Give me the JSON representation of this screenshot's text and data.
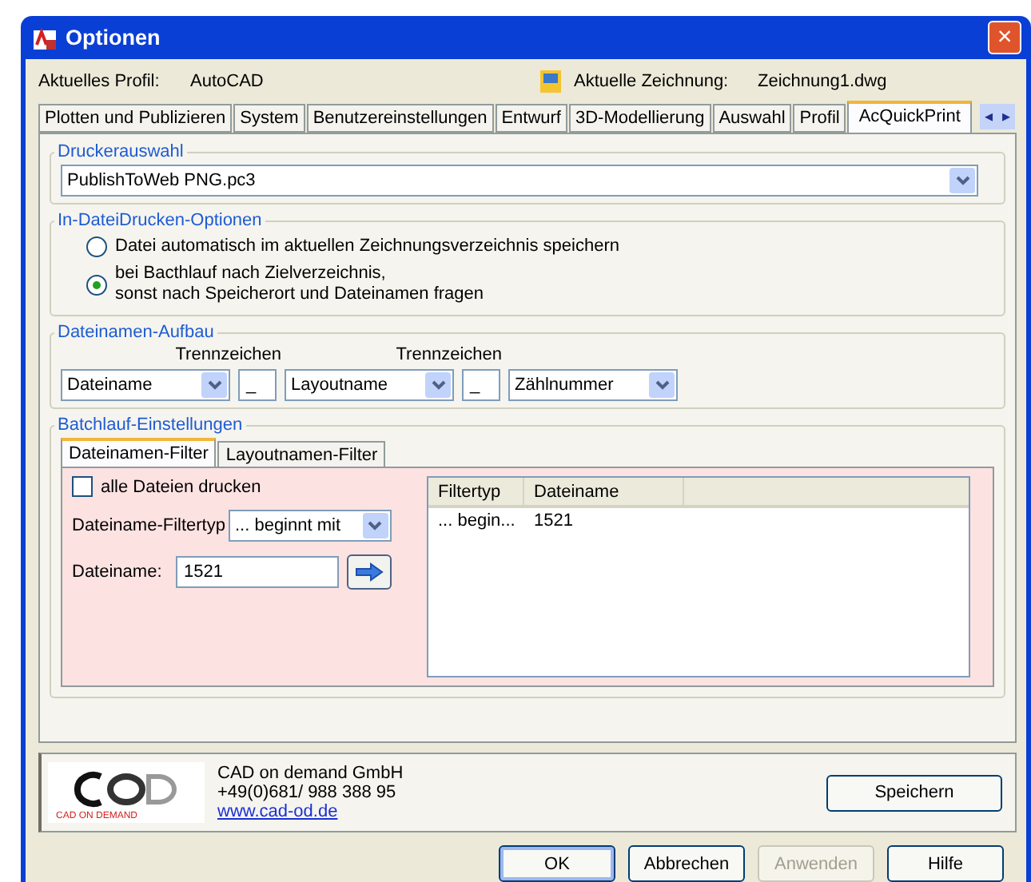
{
  "window": {
    "title": "Optionen",
    "close": "×"
  },
  "profile": {
    "label": "Aktuelles Profil:",
    "value": "AutoCAD",
    "drawing_label": "Aktuelle Zeichnung:",
    "drawing_value": "Zeichnung1.dwg"
  },
  "tabs": [
    {
      "label": "Plotten und Publizieren",
      "selected": false
    },
    {
      "label": "System",
      "selected": false
    },
    {
      "label": "Benutzereinstellungen",
      "selected": false
    },
    {
      "label": "Entwurf",
      "selected": false
    },
    {
      "label": "3D-Modellierung",
      "selected": false
    },
    {
      "label": "Auswahl",
      "selected": false
    },
    {
      "label": "Profil",
      "selected": false
    },
    {
      "label": "AcQuickPrint",
      "selected": true
    }
  ],
  "tab_scroll": [
    "◂",
    "▸"
  ],
  "printer": {
    "legend": "Druckerauswahl",
    "value": "PublishToWeb PNG.pc3"
  },
  "print_to_file": {
    "legend": "In-DateiDrucken-Optionen",
    "options": [
      {
        "label": "Datei automatisch im aktuellen Zeichnungsverzeichnis speichern",
        "selected": false
      },
      {
        "label": "bei Bacthlauf nach Zielverzeichnis,\nsonst nach Speicherort und Dateinamen fragen",
        "selected": true
      }
    ]
  },
  "filename_build": {
    "legend": "Dateinamen-Aufbau",
    "separator_labels": [
      "Trennzeichen",
      "Trennzeichen"
    ],
    "part_1": "Dateiname",
    "separator_1": "_",
    "part_2": "Layoutname",
    "separator_2": "_",
    "part_3": "Zählnummer"
  },
  "batch": {
    "legend": "Batchlauf-Einstellungen",
    "tabs": [
      {
        "label": "Dateinamen-Filter",
        "selected": true
      },
      {
        "label": "Layoutnamen-Filter",
        "selected": false
      }
    ],
    "all_files": {
      "label": "alle Dateien drucken",
      "checked": false
    },
    "filter_type": {
      "label": "Dateiname-Filtertyp",
      "value": "... beginnt mit"
    },
    "filename": {
      "label": "Dateiname:",
      "value": "1521"
    },
    "table": {
      "columns": [
        "Filtertyp",
        "Dateiname"
      ],
      "rows": [
        [
          "... begin...",
          "1521"
        ]
      ]
    }
  },
  "vendor": {
    "logo_tagline": "CAD ON DEMAND",
    "name": "CAD on demand GmbH",
    "phone": "+49(0)681/ 988 388 95",
    "link": "www.cad-od.de",
    "save": "Speichern"
  },
  "buttons": [
    {
      "label": "OK",
      "disabled": false,
      "default": true
    },
    {
      "label": "Abbrechen",
      "disabled": false,
      "default": false
    },
    {
      "label": "Anwenden",
      "disabled": true,
      "default": false
    },
    {
      "label": "Hilfe",
      "disabled": false,
      "default": false
    }
  ]
}
